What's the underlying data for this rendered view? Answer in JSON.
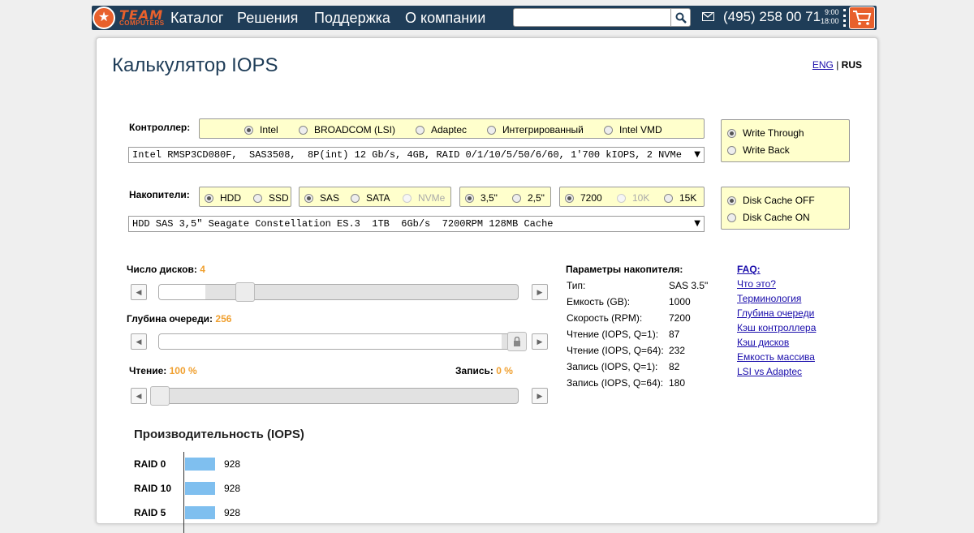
{
  "header": {
    "logo_top": "TEAM",
    "logo_bottom": "COMPUTERS",
    "nav": [
      "Каталог",
      "Решения",
      "Поддержка",
      "О компании"
    ],
    "phone": "(495) 258 00 71",
    "hours_open": "9:00",
    "hours_close": "18:00",
    "search_placeholder": ""
  },
  "page": {
    "title": "Калькулятор IOPS",
    "lang_eng": "ENG",
    "lang_sep": "|",
    "lang_rus": "RUS"
  },
  "controller": {
    "label": "Контроллер:",
    "options": [
      "Intel",
      "BROADCOM (LSI)",
      "Adaptec",
      "Интегрированный",
      "Intel VMD"
    ],
    "selected": "Intel",
    "model": "Intel RMSP3CD080F,  SAS3508,  8P(int) 12 Gb/s, 4GB, RAID 0/1/10/5/50/6/60, 1'700 kIOPS, 2 NVMe",
    "write_modes": [
      "Write Through",
      "Write Back"
    ],
    "write_selected": "Write Through"
  },
  "drives": {
    "label": "Накопители:",
    "media": [
      "HDD",
      "SSD"
    ],
    "media_selected": "HDD",
    "interface": [
      "SAS",
      "SATA",
      "NVMe"
    ],
    "interface_selected": "SAS",
    "form": [
      "3,5\"",
      "2,5\""
    ],
    "form_selected": "3,5\"",
    "rpm": [
      "7200",
      "10K",
      "15K"
    ],
    "rpm_selected": "7200",
    "model": "HDD SAS 3,5\" Seagate Constellation ES.3  1TB  6Gb/s  7200RPM 128MB Cache",
    "cache_modes": [
      "Disk Cache OFF",
      "Disk Cache ON"
    ],
    "cache_selected": "Disk Cache OFF"
  },
  "sliders": {
    "disks_label": "Число дисков:",
    "disks_value": "4",
    "disks_fraction": 0.13,
    "queue_label": "Глубина очереди:",
    "queue_value": "256",
    "queue_fraction": 1.0,
    "read_label": "Чтение:",
    "read_value": "100 %",
    "write_label": "Запись:",
    "write_value": "0 %",
    "mix_fraction": 0.0
  },
  "params": {
    "title": "Параметры накопителя:",
    "rows": [
      {
        "k": "Тип:",
        "v": "SAS 3.5\""
      },
      {
        "k": "Емкость (GB):",
        "v": "1000"
      },
      {
        "k": "Скорость (RPM):",
        "v": "7200"
      },
      {
        "k": "Чтение (IOPS, Q=1):",
        "v": "87"
      },
      {
        "k": "Чтение (IOPS, Q=64):",
        "v": "232"
      },
      {
        "k": "Запись (IOPS, Q=1):",
        "v": "82"
      },
      {
        "k": "Запись (IOPS, Q=64):",
        "v": "180"
      }
    ]
  },
  "faq": {
    "title": "FAQ:",
    "links": [
      "Что это?",
      "Терминология",
      "Глубина очереди",
      "Кэш контроллера",
      "Кэш дисков",
      "Емкость массива",
      "LSI vs Adaptec"
    ]
  },
  "chart_data": {
    "type": "bar",
    "title": "Производительность (IOPS)",
    "categories": [
      "RAID 0",
      "RAID 10",
      "RAID 5"
    ],
    "values": [
      928,
      928,
      928
    ],
    "value_labels": [
      "928",
      "928",
      "928"
    ],
    "color": "#7fbfef"
  },
  "colors": {
    "nav_bg": "#1f3d58",
    "accent": "#e8602c",
    "highlight_value": "#f0a030",
    "option_bg": "#ffffcc",
    "bar": "#7fbfef"
  }
}
